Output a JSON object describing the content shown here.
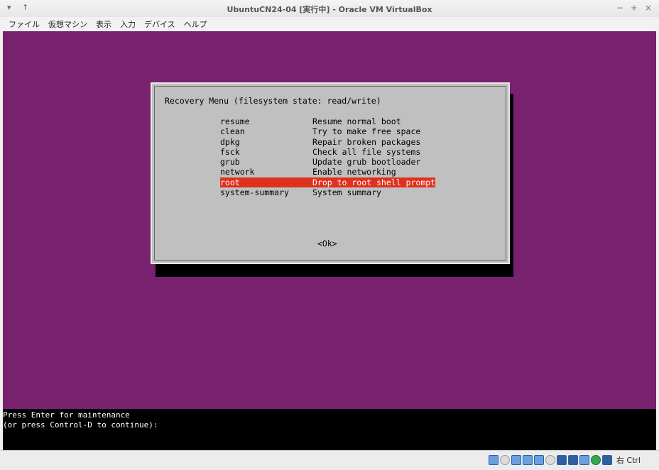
{
  "window": {
    "title": "UbuntuCN24-04 [実行中] - Oracle VM VirtualBox",
    "left_controls": "▾ ↑",
    "right_controls": [
      "−",
      "+",
      "×"
    ]
  },
  "menubar": [
    "ファイル",
    "仮想マシン",
    "表示",
    "入力",
    "デバイス",
    "ヘルプ"
  ],
  "dialog": {
    "title": "Recovery Menu (filesystem state: read/write)",
    "items": [
      {
        "key": "resume",
        "desc": "Resume normal boot"
      },
      {
        "key": "clean",
        "desc": "Try to make free space"
      },
      {
        "key": "dpkg",
        "desc": "Repair broken packages"
      },
      {
        "key": "fsck",
        "desc": "Check all file systems"
      },
      {
        "key": "grub",
        "desc": "Update grub bootloader"
      },
      {
        "key": "network",
        "desc": "Enable networking"
      },
      {
        "key": "root",
        "desc": "Drop to root shell prompt"
      },
      {
        "key": "system-summary",
        "desc": "System summary"
      }
    ],
    "selected_index": 6,
    "ok_label": "<Ok>"
  },
  "console": {
    "line1": "Press Enter for maintenance",
    "line2": "(or press Control-D to continue):"
  },
  "statusbar": {
    "icons": [
      "hard-disk-icon",
      "optical-drive-icon",
      "audio-icon",
      "network-icon",
      "usb-icon",
      "shared-folder-icon",
      "display-icon",
      "video-capture-icon",
      "cpu-icon",
      "mouse-integration-icon",
      "keyboard-capture-icon"
    ],
    "host_key": "右 Ctrl"
  },
  "colors": {
    "vm_background": "#77216f",
    "dialog_background": "#c0c0c0",
    "selection": "#e0301e"
  }
}
